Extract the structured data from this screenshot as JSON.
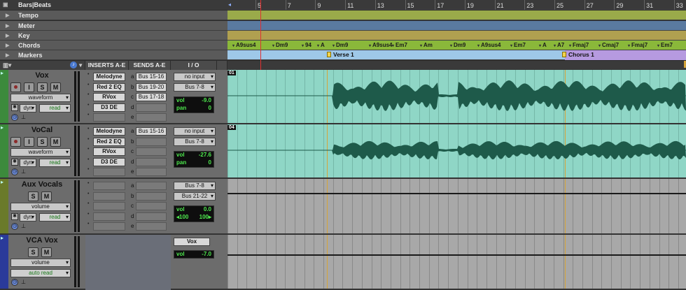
{
  "ruler": {
    "timebase_label": "Bars|Beats",
    "bars": [
      "5",
      "7",
      "9",
      "11",
      "13",
      "15",
      "17",
      "19",
      "21",
      "23",
      "25",
      "27",
      "29",
      "31",
      "33"
    ],
    "rows": [
      {
        "label": "Tempo"
      },
      {
        "label": "Meter"
      },
      {
        "label": "Key"
      },
      {
        "label": "Chords"
      },
      {
        "label": "Markers"
      }
    ]
  },
  "chords": [
    "A9sus4",
    "Dm9",
    "94",
    "A",
    "Dm9",
    "A9sus4",
    "Em7",
    "Am",
    "Dm9",
    "A9sus4",
    "Em7",
    "A",
    "A7",
    "Fmaj7",
    "Cmaj7",
    "Fmaj7",
    "Em7"
  ],
  "markers": [
    {
      "label": "Verse 1"
    },
    {
      "label": "Chorus 1"
    }
  ],
  "columns": {
    "inserts": "INSERTS A-E",
    "sends": "SENDS A-E",
    "io": "I / O"
  },
  "tracks": [
    {
      "name": "Vox",
      "color": "#3c8a3c",
      "buttons": {
        "input": "I",
        "solo": "S",
        "mute": "M"
      },
      "view": "waveform",
      "automation": "dyn",
      "mode": "read",
      "inserts": [
        "Melodyne",
        "Red 2 EQ",
        "RVox",
        "D3 DE",
        ""
      ],
      "sends": [
        {
          "letter": "a",
          "name": "Bus 15-16"
        },
        {
          "letter": "b",
          "name": "Bus 19-20"
        },
        {
          "letter": "c",
          "name": "Bus 17-18"
        },
        {
          "letter": "d",
          "name": ""
        },
        {
          "letter": "e",
          "name": ""
        }
      ],
      "input": "no input",
      "output": "Bus 7-8",
      "vol": "-9.0",
      "pan": "0",
      "region": "01"
    },
    {
      "name": "VoCal",
      "color": "#3c8a3c",
      "buttons": {
        "input": "I",
        "solo": "S",
        "mute": "M"
      },
      "view": "waveform",
      "automation": "dyn",
      "mode": "read",
      "inserts": [
        "Melodyne",
        "Red 2 EQ",
        "RVox",
        "D3 DE",
        ""
      ],
      "sends": [
        {
          "letter": "a",
          "name": "Bus 15-16"
        },
        {
          "letter": "b",
          "name": ""
        },
        {
          "letter": "c",
          "name": ""
        },
        {
          "letter": "d",
          "name": ""
        },
        {
          "letter": "e",
          "name": ""
        }
      ],
      "input": "no input",
      "output": "Bus 7-8",
      "vol": "-27.6",
      "pan": "0",
      "region": "04"
    },
    {
      "name": "Aux Vocals",
      "color": "#6a7a2a",
      "buttons": {
        "solo": "S",
        "mute": "M"
      },
      "view": "volume",
      "automation": "dyn",
      "mode": "read",
      "inserts": [
        "",
        "",
        "",
        "",
        ""
      ],
      "sends": [
        {
          "letter": "a",
          "name": ""
        },
        {
          "letter": "b",
          "name": ""
        },
        {
          "letter": "c",
          "name": ""
        },
        {
          "letter": "d",
          "name": ""
        },
        {
          "letter": "e",
          "name": ""
        }
      ],
      "input": "Bus 7-8",
      "output": "Bus 21-22",
      "vol": "0.0",
      "pan_left": "◂100",
      "pan_right": "100▸"
    },
    {
      "name": "VCA Vox",
      "color": "#2a3a9a",
      "buttons": {
        "solo": "S",
        "mute": "M"
      },
      "view": "volume",
      "mode": "auto read",
      "io_group": "Vox",
      "vol": "-7.0"
    }
  ],
  "labels": {
    "vol": "vol",
    "pan": "pan"
  }
}
